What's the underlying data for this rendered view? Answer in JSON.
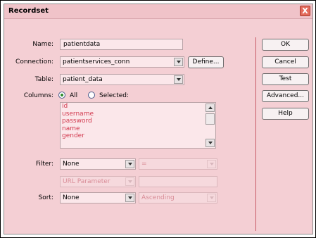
{
  "window": {
    "title": "Recordset",
    "close_glyph": "X"
  },
  "form": {
    "name_label": "Name:",
    "name_value": "patientdata",
    "connection_label": "Connection:",
    "connection_value": "patientservices_conn",
    "define_button": "Define...",
    "table_label": "Table:",
    "table_value": "patient_data",
    "columns_label": "Columns:",
    "columns_all": "All",
    "columns_selected": "Selected:",
    "columns_mode": "All",
    "column_items": [
      "id",
      "username",
      "password",
      "name",
      "gender"
    ],
    "filter_label": "Filter:",
    "filter_value": "None",
    "filter_operator": "=",
    "filter_param_type": "URL Parameter",
    "filter_param_value": "",
    "sort_label": "Sort:",
    "sort_value": "None",
    "sort_order": "Ascending"
  },
  "buttons": {
    "ok": "OK",
    "cancel": "Cancel",
    "test": "Test",
    "advanced": "Advanced...",
    "help": "Help"
  },
  "colors": {
    "dialog_bg": "#f4cfd4",
    "list_text": "#d23a4f",
    "close_bg": "#e46b5c"
  }
}
